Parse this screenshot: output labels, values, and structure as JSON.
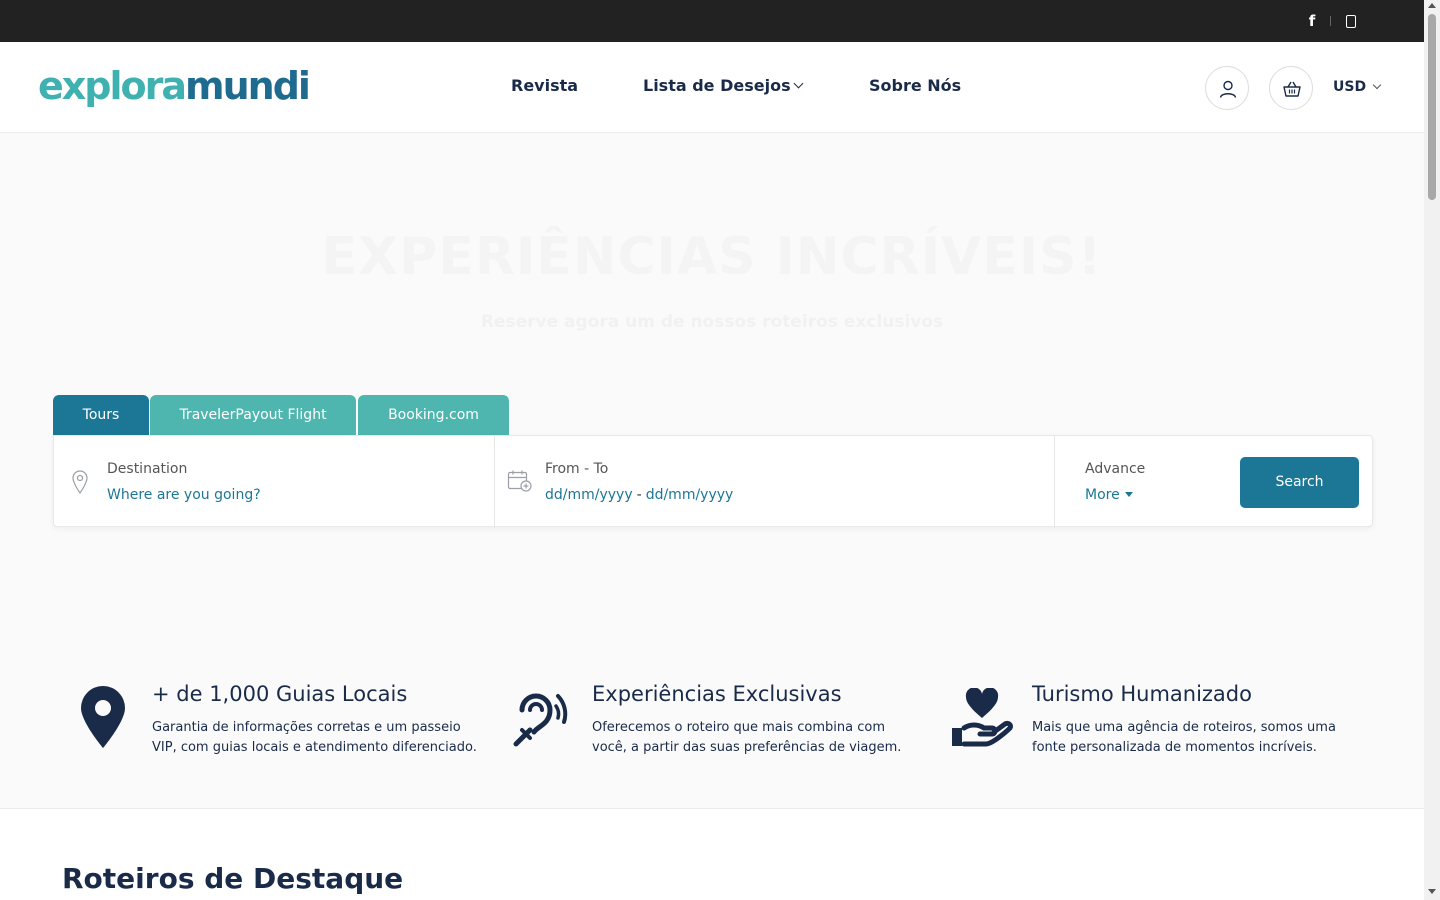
{
  "topbar": {
    "social": [
      {
        "icon": "facebook-icon",
        "glyph": "f"
      },
      {
        "icon": "instagram-icon"
      }
    ]
  },
  "header": {
    "logo": {
      "part1": "explora",
      "part2": "mundi"
    },
    "nav": [
      {
        "label": "Revista"
      },
      {
        "label": "Lista de Desejos",
        "has_dropdown": true
      },
      {
        "label": "Sobre Nós"
      }
    ],
    "account_icon": "user-icon",
    "cart_icon": "basket-icon",
    "currency": "USD"
  },
  "hero": {
    "title": "EXPERIÊNCIAS INCRÍVEIS!",
    "subtitle": "Reserve agora um de nossos roteiros exclusivos"
  },
  "search": {
    "tabs": [
      {
        "label": "Tours",
        "active": true
      },
      {
        "label": "TravelerPayout Flight",
        "active": false
      },
      {
        "label": "Booking.com",
        "active": false
      }
    ],
    "destination": {
      "label": "Destination",
      "placeholder": "Where are you going?"
    },
    "dates": {
      "label": "From - To",
      "from": "dd/mm/yyyy",
      "separator": "-",
      "to": "dd/mm/yyyy"
    },
    "advance": {
      "label": "Advance",
      "more": "More"
    },
    "button": "Search"
  },
  "features": [
    {
      "icon": "map-pin-icon",
      "title": "+ de 1,000 Guias Locais",
      "description": "Garantia de informações corretas e um passeio VIP, com guias locais e atendimento diferenciado."
    },
    {
      "icon": "hearing-icon",
      "title": "Experiências Exclusivas",
      "description": "Oferecemos o roteiro que mais combina com você, a partir das suas preferências de viagem."
    },
    {
      "icon": "hand-heart-icon",
      "title": "Turismo Humanizado",
      "description": "Mais que uma agência de roteiros, somos uma fonte personalizada de momentos incríveis."
    }
  ],
  "featured_section": {
    "title": "Roteiros de Destaque"
  },
  "colors": {
    "primary": "#1c7797",
    "secondary": "#4eb6ae",
    "navy": "#1a2b49",
    "topbar": "#222222"
  }
}
